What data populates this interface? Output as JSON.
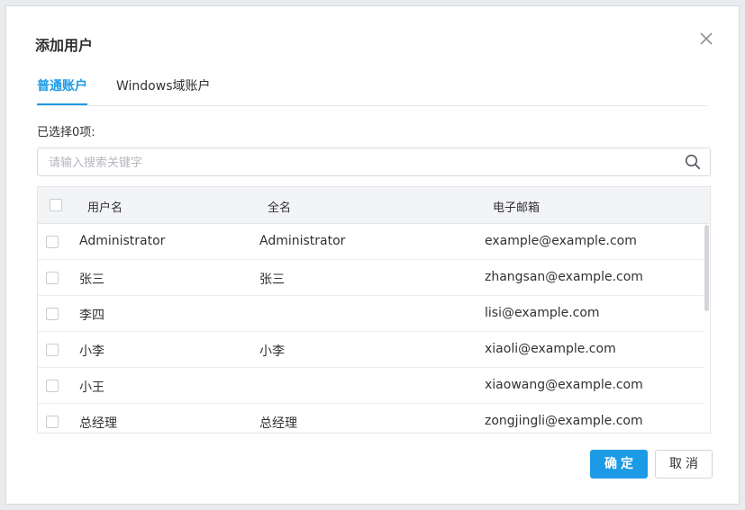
{
  "dialog": {
    "title": "添加用户",
    "tabs": [
      {
        "label": "普通账户",
        "active": true
      },
      {
        "label": "Windows域账户",
        "active": false
      }
    ],
    "selected_count_label": "已选择0项:",
    "search": {
      "placeholder": "请输入搜索关键字",
      "value": ""
    },
    "table": {
      "columns": [
        "用户名",
        "全名",
        "电子邮箱"
      ],
      "rows": [
        {
          "username": "Administrator",
          "fullname": "Administrator",
          "email": "example@example.com"
        },
        {
          "username": "张三",
          "fullname": "张三",
          "email": "zhangsan@example.com"
        },
        {
          "username": "李四",
          "fullname": "",
          "email": "lisi@example.com"
        },
        {
          "username": "小李",
          "fullname": "小李",
          "email": "xiaoli@example.com"
        },
        {
          "username": "小王",
          "fullname": "",
          "email": "xiaowang@example.com"
        },
        {
          "username": "总经理",
          "fullname": "总经理",
          "email": "zongjingli@example.com"
        }
      ]
    },
    "buttons": {
      "confirm": "确定",
      "cancel": "取消"
    }
  },
  "colors": {
    "accent": "#1d9ae6",
    "header_bg": "#f3f4f6"
  },
  "icons": {
    "close": "close-icon",
    "search": "search-icon"
  }
}
